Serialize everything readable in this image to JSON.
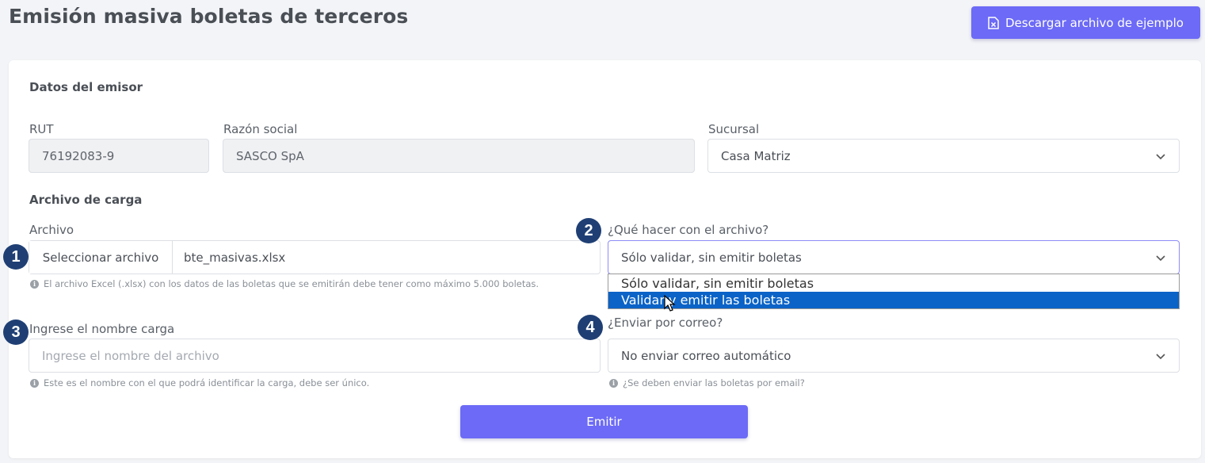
{
  "page": {
    "title": "Emisión masiva boletas de terceros",
    "download_button": "Descargar archivo de ejemplo"
  },
  "emisor": {
    "section_title": "Datos del emisor",
    "rut_label": "RUT",
    "rut_value": "76192083-9",
    "razon_label": "Razón social",
    "razon_value": "SASCO SpA",
    "sucursal_label": "Sucursal",
    "sucursal_value": "Casa Matriz"
  },
  "archivo": {
    "section_title": "Archivo de carga",
    "file_label": "Archivo",
    "file_button": "Seleccionar archivo",
    "file_name": "bte_masivas.xlsx",
    "file_help": "El archivo Excel (.xlsx) con los datos de las boletas que se emitirán debe tener como máximo 5.000 boletas.",
    "action_label": "¿Qué hacer con el archivo?",
    "action_value": "Sólo validar, sin emitir boletas",
    "action_options": [
      "Sólo validar, sin emitir boletas",
      "Validar y emitir las boletas"
    ],
    "action_selected_index": 1,
    "name_label": "Ingrese el nombre carga",
    "name_placeholder": "Ingrese el nombre del archivo",
    "name_help": "Este es el nombre con el que podrá identificar la carga, debe ser único.",
    "email_label": "¿Enviar por correo?",
    "email_value": "No enviar correo automático",
    "email_help": "¿Se deben enviar las boletas por email?"
  },
  "badges": [
    "1",
    "2",
    "3",
    "4"
  ],
  "submit_button": "Emitir",
  "colors": {
    "accent": "#6c6af6",
    "badge": "#1f3f74",
    "dropdown_highlight": "#0b63c7"
  }
}
